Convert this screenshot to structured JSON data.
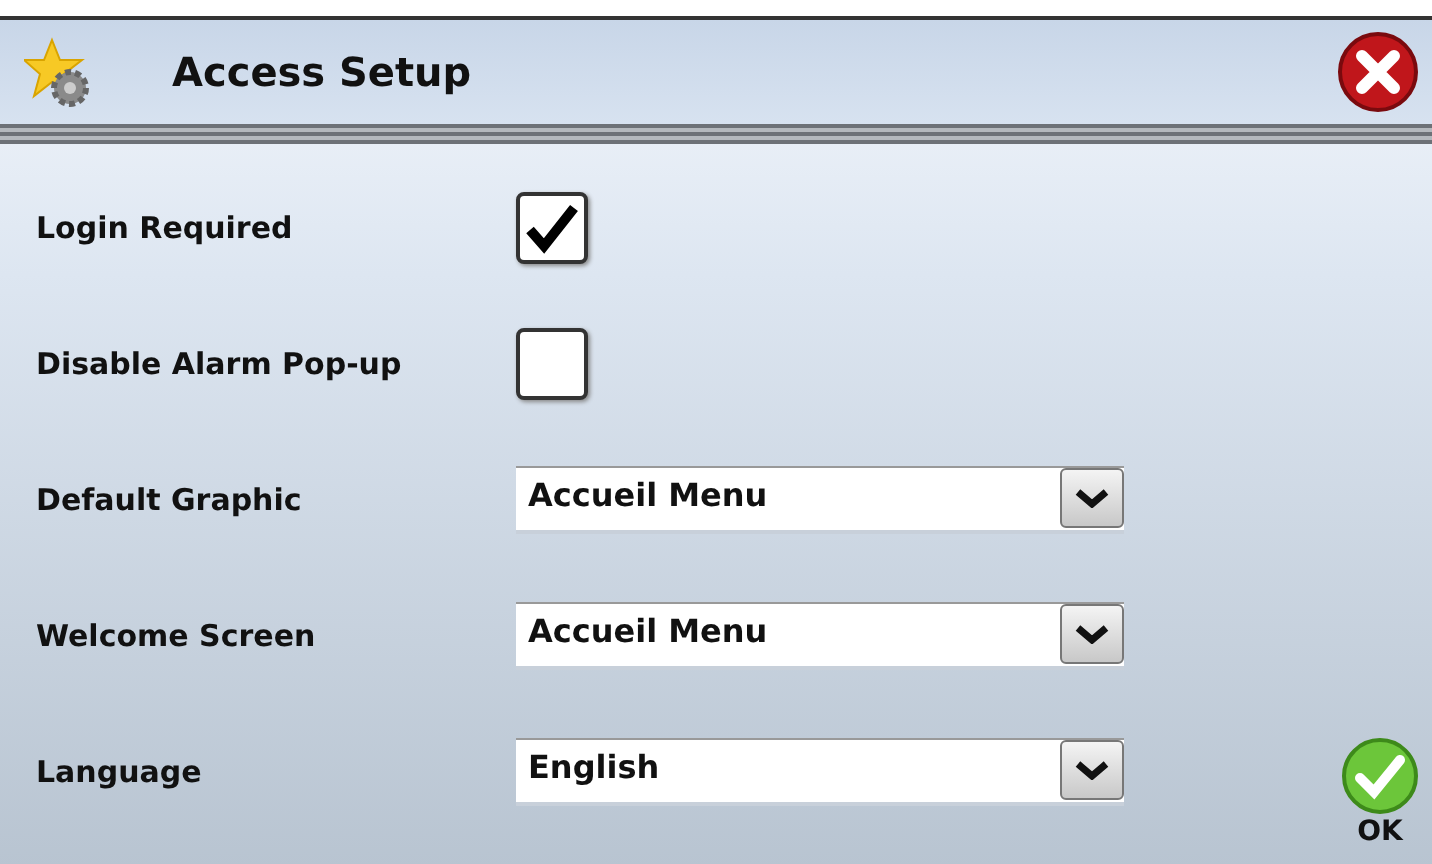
{
  "window": {
    "title": "Access Setup"
  },
  "settings": [
    {
      "kind": "checkbox",
      "label": "Login Required",
      "checked": true
    },
    {
      "kind": "checkbox",
      "label": "Disable Alarm Pop-up",
      "checked": false
    },
    {
      "kind": "dropdown",
      "label": "Default Graphic",
      "value": "Accueil Menu"
    },
    {
      "kind": "dropdown",
      "label": "Welcome Screen",
      "value": "Accueil Menu"
    },
    {
      "kind": "dropdown",
      "label": "Language",
      "value": "English"
    }
  ],
  "ok_button": {
    "label": "OK"
  }
}
